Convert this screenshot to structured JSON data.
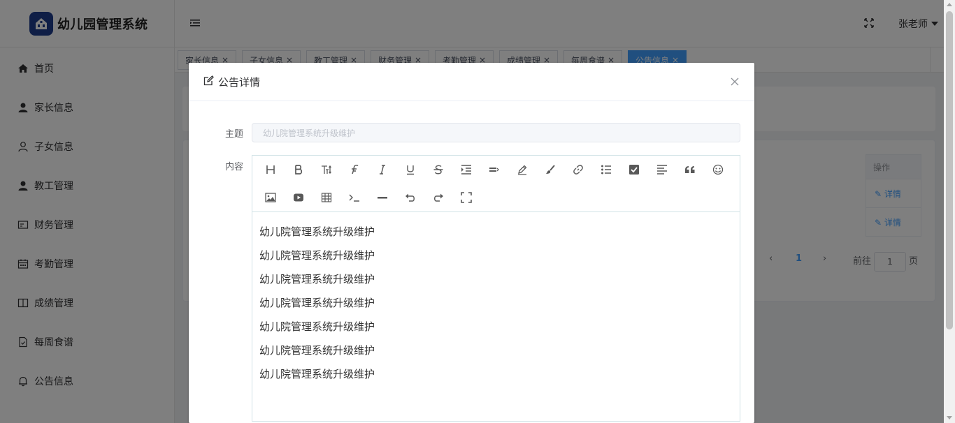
{
  "brand": {
    "title": "幼儿园管理系统"
  },
  "sidebar": {
    "items": [
      {
        "label": "首页",
        "icon": "home-icon"
      },
      {
        "label": "家长信息",
        "icon": "user-solid-icon"
      },
      {
        "label": "子女信息",
        "icon": "user-outline-icon"
      },
      {
        "label": "教工管理",
        "icon": "user-solid-icon"
      },
      {
        "label": "财务管理",
        "icon": "postcard-icon"
      },
      {
        "label": "考勤管理",
        "icon": "calendar-icon"
      },
      {
        "label": "成绩管理",
        "icon": "book-icon"
      },
      {
        "label": "每周食谱",
        "icon": "document-checked-icon"
      },
      {
        "label": "公告信息",
        "icon": "bell-icon"
      }
    ]
  },
  "header": {
    "user_name": "张老师"
  },
  "tabs": [
    {
      "label": "家长信息",
      "active": false
    },
    {
      "label": "子女信息",
      "active": false
    },
    {
      "label": "教工管理",
      "active": false
    },
    {
      "label": "财务管理",
      "active": false
    },
    {
      "label": "考勤管理",
      "active": false
    },
    {
      "label": "成绩管理",
      "active": false
    },
    {
      "label": "每周食谱",
      "active": false
    },
    {
      "label": "公告信息",
      "active": true
    }
  ],
  "background_table": {
    "header_action": "操作",
    "rows": [
      {
        "action": "详情"
      },
      {
        "action": "详情"
      }
    ],
    "pager": {
      "current_page": "1",
      "goto_prefix": "前往",
      "goto_value": "1",
      "goto_suffix": "页"
    }
  },
  "dialog": {
    "title": "公告详情",
    "subject_label": "主题",
    "subject_value": "幼儿院管理系统升级维护",
    "content_label": "内容",
    "content_lines": [
      "幼儿院管理系统升级维护",
      "幼儿院管理系统升级维护",
      "幼儿院管理系统升级维护",
      "幼儿院管理系统升级维护",
      "幼儿院管理系统升级维护",
      "幼儿院管理系统升级维护",
      "幼儿院管理系统升级维护"
    ],
    "toolbar": [
      "heading-icon",
      "bold-icon",
      "font-size-icon",
      "font-family-icon",
      "italic-icon",
      "underline-icon",
      "strikethrough-icon",
      "indent-icon",
      "line-height-icon",
      "font-color-icon",
      "brush-icon",
      "link-icon",
      "unordered-list-icon",
      "todo-icon",
      "align-icon",
      "quote-icon",
      "emoji-icon",
      "image-icon",
      "video-icon",
      "table-icon",
      "code-icon",
      "divider-icon",
      "undo-icon",
      "redo-icon",
      "fullscreen-icon"
    ]
  },
  "colors": {
    "primary": "#409eff",
    "brand_logo": "#1f3d8c",
    "overlay": "rgba(0,0,0,0.5)"
  }
}
